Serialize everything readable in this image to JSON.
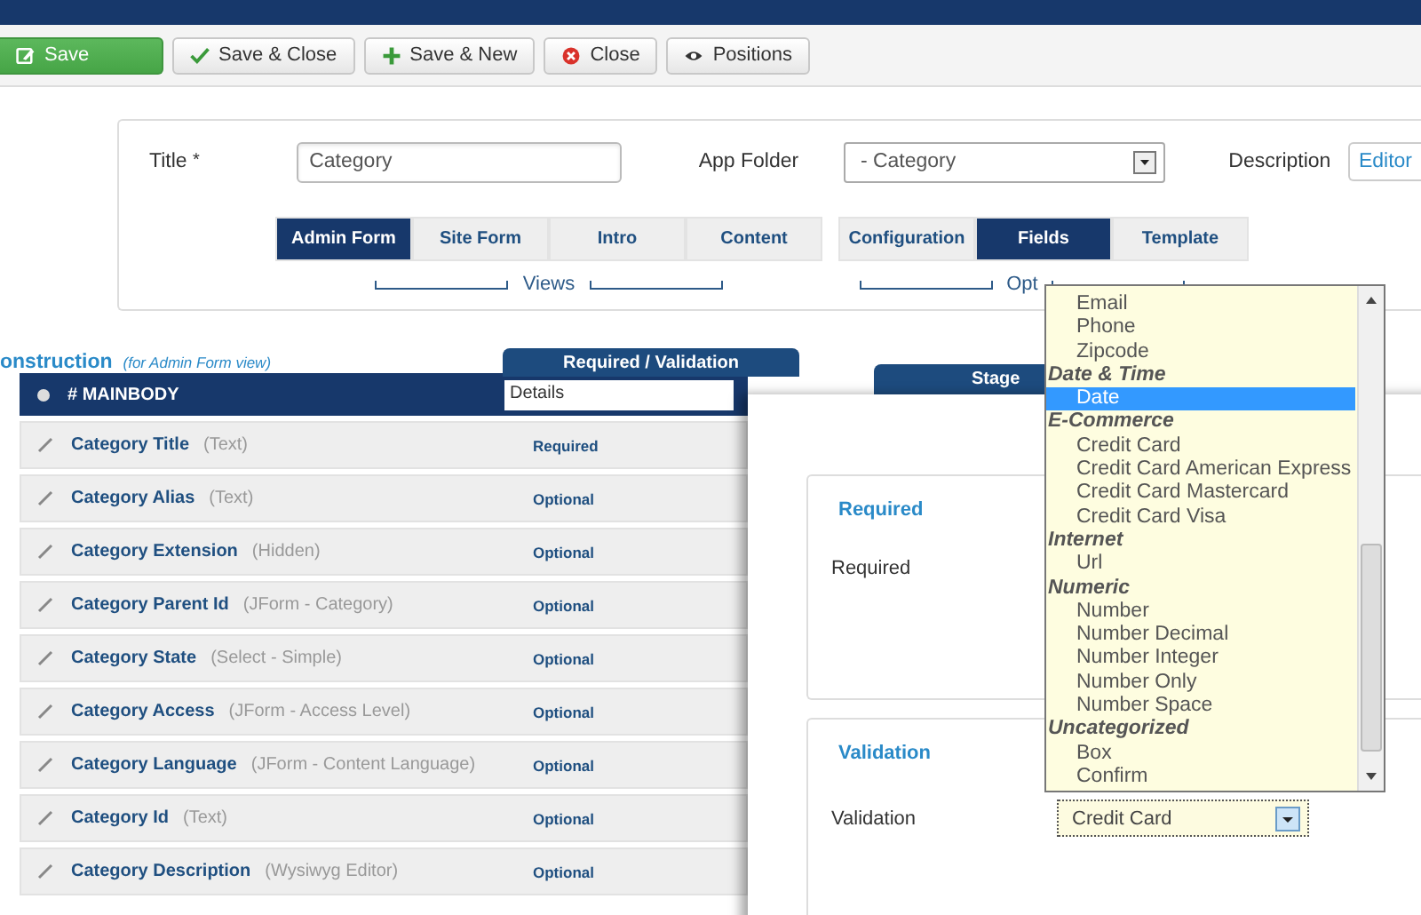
{
  "toolbar": {
    "buttons": [
      {
        "label": "Save",
        "kind": "primary"
      },
      {
        "label": "Save & Close",
        "kind": "default"
      },
      {
        "label": "Save & New",
        "kind": "default"
      },
      {
        "label": "Close",
        "kind": "default"
      },
      {
        "label": "Positions",
        "kind": "default"
      }
    ]
  },
  "form": {
    "title_label": "Title",
    "required_mark": "*",
    "title_value": "Category",
    "app_folder_label": "App Folder",
    "app_folder_value": "- Category",
    "description_label": "Description",
    "description_button": "Editor"
  },
  "views": {
    "label": "Views",
    "tabs": [
      {
        "label": "Admin Form",
        "selected": true
      },
      {
        "label": "Site Form",
        "selected": false
      },
      {
        "label": "Intro",
        "selected": false
      },
      {
        "label": "Content",
        "selected": false
      }
    ]
  },
  "options": {
    "label": "Opt",
    "tabs": [
      {
        "label": "Configuration",
        "selected": false
      },
      {
        "label": "Fields",
        "selected": true
      },
      {
        "label": "Template",
        "selected": false
      }
    ]
  },
  "construction": {
    "title": "onstruction",
    "subtitle": "(for Admin Form view)",
    "header_tab": "Required / Validation",
    "stage_tab": "Stage",
    "mainbody": "# MAINBODY",
    "details_value": "Details",
    "rows": [
      {
        "name": "Category Title",
        "type": "(Text)",
        "status": "Required"
      },
      {
        "name": "Category Alias",
        "type": "(Text)",
        "status": "Optional"
      },
      {
        "name": "Category Extension",
        "type": "(Hidden)",
        "status": "Optional"
      },
      {
        "name": "Category Parent Id",
        "type": "(JForm - Category)",
        "status": "Optional"
      },
      {
        "name": "Category State",
        "type": "(Select - Simple)",
        "status": "Optional"
      },
      {
        "name": "Category Access",
        "type": "(JForm - Access Level)",
        "status": "Optional"
      },
      {
        "name": "Category Language",
        "type": "(JForm - Content Language)",
        "status": "Optional"
      },
      {
        "name": "Category Id",
        "type": "(Text)",
        "status": "Optional"
      },
      {
        "name": "Category Description",
        "type": "(Wysiwyg Editor)",
        "status": "Optional"
      }
    ]
  },
  "details_panel": {
    "required_heading": "Required",
    "required_label": "Required",
    "validation_heading": "Validation",
    "validation_label": "Validation",
    "validation_value": "Credit Card"
  },
  "dropdown": {
    "options": [
      {
        "label": "Email",
        "kind": "option",
        "selected": false
      },
      {
        "label": "Phone",
        "kind": "option",
        "selected": false
      },
      {
        "label": "Zipcode",
        "kind": "option",
        "selected": false
      },
      {
        "label": "Date & Time",
        "kind": "group",
        "selected": false
      },
      {
        "label": "Date",
        "kind": "option",
        "selected": true
      },
      {
        "label": "E-Commerce",
        "kind": "group",
        "selected": false
      },
      {
        "label": "Credit Card",
        "kind": "option",
        "selected": false
      },
      {
        "label": "Credit Card American Express",
        "kind": "option",
        "selected": false
      },
      {
        "label": "Credit Card Mastercard",
        "kind": "option",
        "selected": false
      },
      {
        "label": "Credit Card Visa",
        "kind": "option",
        "selected": false
      },
      {
        "label": "Internet",
        "kind": "group",
        "selected": false
      },
      {
        "label": "Url",
        "kind": "option",
        "selected": false
      },
      {
        "label": "Numeric",
        "kind": "group",
        "selected": false
      },
      {
        "label": "Number",
        "kind": "option",
        "selected": false
      },
      {
        "label": "Number Decimal",
        "kind": "option",
        "selected": false
      },
      {
        "label": "Number Integer",
        "kind": "option",
        "selected": false
      },
      {
        "label": "Number Only",
        "kind": "option",
        "selected": false
      },
      {
        "label": "Number Space",
        "kind": "option",
        "selected": false
      },
      {
        "label": "Uncategorized",
        "kind": "group",
        "selected": false
      },
      {
        "label": "Box",
        "kind": "option",
        "selected": false
      },
      {
        "label": "Confirm",
        "kind": "option",
        "selected": false
      }
    ]
  }
}
